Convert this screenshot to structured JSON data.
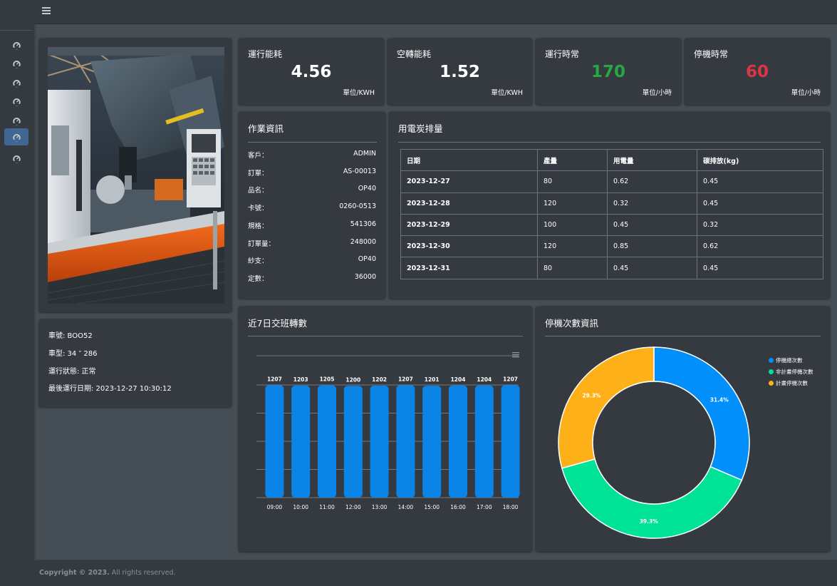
{
  "topbar": {
    "menu_icon": "hamburger-icon"
  },
  "sidebar": {
    "items": [
      {
        "icon": "tachometer-icon",
        "active": false
      },
      {
        "icon": "tachometer-icon",
        "active": false
      },
      {
        "icon": "tachometer-icon",
        "active": false
      },
      {
        "icon": "tachometer-icon",
        "active": false
      },
      {
        "icon": "tachometer-icon",
        "active": false
      },
      {
        "icon": "tachometer-icon",
        "active": true
      },
      {
        "icon": "tachometer-icon",
        "active": false
      }
    ]
  },
  "machine_info": {
    "machine_no": "車號: BOO52",
    "model": "車型: 34 ″ 286",
    "status": "運行狀態: 正常",
    "last_run": "最後運行日期: 2023-12-27 10:30:12"
  },
  "stats": [
    {
      "title": "運行能耗",
      "value": "4.56",
      "unit": "單位/KWH",
      "color": "#ffffff"
    },
    {
      "title": "空轉能耗",
      "value": "1.52",
      "unit": "單位/KWH",
      "color": "#ffffff"
    },
    {
      "title": "運行時常",
      "value": "170",
      "unit": "單位/小時",
      "color": "#28a745"
    },
    {
      "title": "停機時常",
      "value": "60",
      "unit": "單位/小時",
      "color": "#dc3545"
    }
  ],
  "job_info": {
    "title": "作業資訊",
    "rows": [
      {
        "key": "客戶：",
        "value": "ADMIN"
      },
      {
        "key": "訂單：",
        "value": "AS-00013"
      },
      {
        "key": "品名：",
        "value": "OP40"
      },
      {
        "key": "卡號：",
        "value": "0260-0513"
      },
      {
        "key": "規格：",
        "value": "541306"
      },
      {
        "key": "訂單量：",
        "value": "248000"
      },
      {
        "key": "紗支：",
        "value": "OP40"
      },
      {
        "key": "定數：",
        "value": "36000"
      }
    ]
  },
  "carbon": {
    "title": "用電炭排量",
    "headers": [
      "日期",
      "產量",
      "用電量",
      "碳排放(kg)"
    ],
    "rows": [
      [
        "2023-12-27",
        "80",
        "0.62",
        "0.45"
      ],
      [
        "2023-12-28",
        "120",
        "0.32",
        "0.45"
      ],
      [
        "2023-12-29",
        "100",
        "0.45",
        "0.32"
      ],
      [
        "2023-12-30",
        "120",
        "0.85",
        "0.62"
      ],
      [
        "2023-12-31",
        "80",
        "0.45",
        "0.45"
      ]
    ]
  },
  "shift_chart": {
    "title": "近7日交班轉數",
    "menu_icon": "chart-menu-icon"
  },
  "downtime_chart": {
    "title": "停機次數資訊"
  },
  "chart_data": [
    {
      "type": "bar",
      "categories": [
        "09:00",
        "10:00",
        "11:00",
        "12:00",
        "13:00",
        "14:00",
        "15:00",
        "16:00",
        "17:00",
        "18:00"
      ],
      "values": [
        1207,
        1203,
        1205,
        1200,
        1202,
        1207,
        1201,
        1204,
        1204,
        1207
      ],
      "color": "#0a84e6",
      "grid": true
    },
    {
      "type": "pie",
      "donut": true,
      "labels": [
        "停機總次數",
        "非計畫停機次數",
        "計畫停機次數"
      ],
      "values": [
        31.4,
        39.3,
        29.3
      ],
      "value_labels": [
        "31.4%",
        "39.3%",
        "29.3%"
      ],
      "colors": [
        "#008ffb",
        "#00e396",
        "#feb019"
      ],
      "legend": "top-right"
    }
  ],
  "footer": {
    "copyright_bold": "Copyright © 2023.",
    "copyright_rest": " All rights reserved."
  }
}
